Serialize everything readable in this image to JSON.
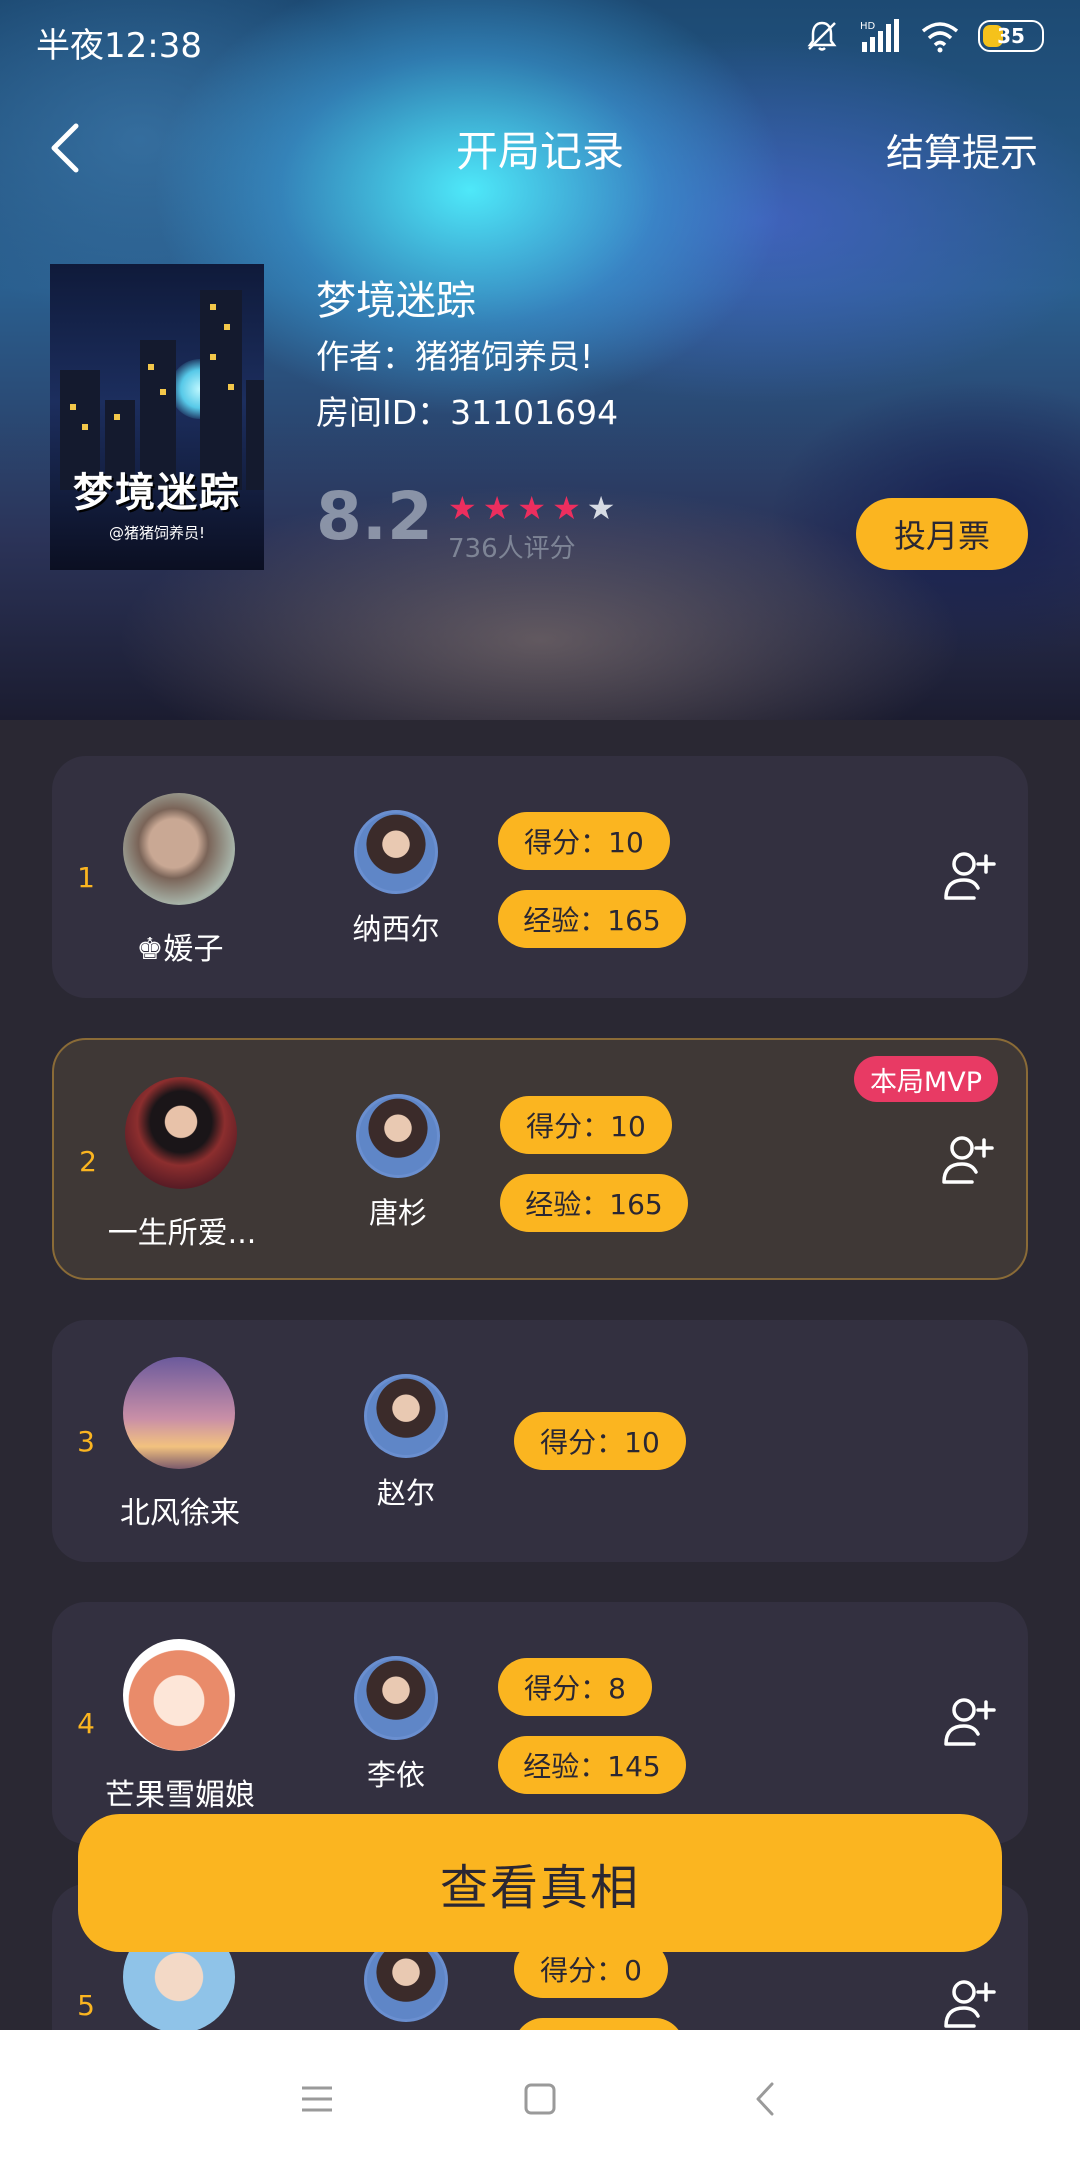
{
  "status": {
    "time": "半夜12:38",
    "battery": "35",
    "network": "HD"
  },
  "nav": {
    "title": "开局记录",
    "right_action": "结算提示"
  },
  "story": {
    "cover_title": "梦境迷踪",
    "cover_author": "@猪猪饲养员!",
    "title": "梦境迷踪",
    "author": "作者：猪猪饲养员!",
    "room": "房间ID：31101694",
    "score": "8.2",
    "rating_count": "736人评分",
    "stars_filled": 4,
    "vote_label": "投月票"
  },
  "players": [
    {
      "rank": "1",
      "name": "♚媛子",
      "character": "纳西尔",
      "score": "得分：10",
      "exp": "经验：165",
      "mvp": false
    },
    {
      "rank": "2",
      "name": "一生所爱...",
      "character": "唐杉",
      "score": "得分：10",
      "exp": "经验：165",
      "mvp": true,
      "mvp_label": "本局MVP"
    },
    {
      "rank": "3",
      "name": "北风徐来",
      "character": "赵尔",
      "score": "得分：10",
      "exp": "",
      "mvp": false
    },
    {
      "rank": "4",
      "name": "芒果雪媚娘",
      "character": "李依",
      "score": "得分：8",
      "exp": "经验：145",
      "mvp": false
    },
    {
      "rank": "5",
      "name": "",
      "character": "",
      "score": "得分：0",
      "exp": "",
      "mvp": false
    }
  ],
  "reveal_label": "查看真相",
  "colors": {
    "accent": "#fbb520",
    "mvp": "#e83a64",
    "card": "#333040",
    "background": "#2a2833"
  }
}
